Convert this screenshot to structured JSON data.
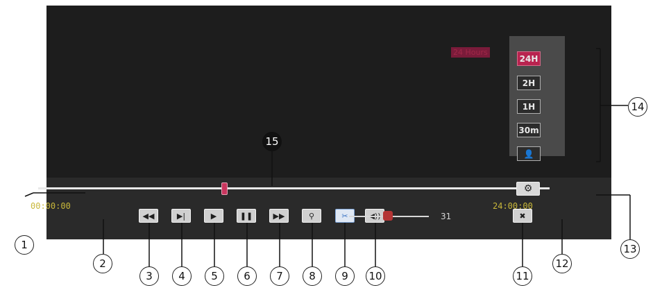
{
  "playback": {
    "start_time": "00:00:00",
    "end_time": "24:00:00",
    "volume_value": "31",
    "settings_icon": "gear-icon"
  },
  "time_range": {
    "label": "24 Hours",
    "buttons": [
      "24H",
      "2H",
      "1H",
      "30m"
    ],
    "selected": "24H",
    "person_icon": "person-icon"
  },
  "controls": [
    {
      "name": "rewind-button",
      "icon": "rewind-icon"
    },
    {
      "name": "step-forward-button",
      "icon": "step-forward-icon"
    },
    {
      "name": "play-button",
      "icon": "play-icon"
    },
    {
      "name": "pause-button",
      "icon": "pause-icon"
    },
    {
      "name": "fast-forward-button",
      "icon": "fast-forward-icon"
    },
    {
      "name": "zoom-button",
      "icon": "magnifier-icon"
    },
    {
      "name": "clip-button",
      "icon": "scissors-icon"
    },
    {
      "name": "volume-button",
      "icon": "speaker-icon"
    },
    {
      "name": "close-button",
      "icon": "close-icon"
    }
  ],
  "callouts": [
    "1",
    "2",
    "3",
    "4",
    "5",
    "6",
    "7",
    "8",
    "9",
    "10",
    "11",
    "12",
    "13",
    "14",
    "15"
  ],
  "colors": {
    "timestamp": "#c9b83a",
    "selected_range": "#b8234f",
    "thumb": "#c8365e",
    "panel": "#2a2a2a"
  }
}
